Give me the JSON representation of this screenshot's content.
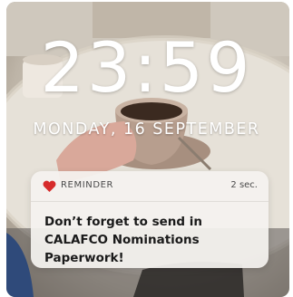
{
  "lockscreen": {
    "time": "23:59",
    "date": "MONDAY, 16 SEPTEMBER"
  },
  "notification": {
    "app_name": "REMINDER",
    "icon": "heart-icon",
    "time_ago": "2 sec.",
    "message": "Don’t forget to send in CALAFCO Nominations Paperwork!"
  },
  "colors": {
    "heart": "#d62b2b",
    "text_light": "#ffffff",
    "card_bg": "#f4f2ef"
  }
}
